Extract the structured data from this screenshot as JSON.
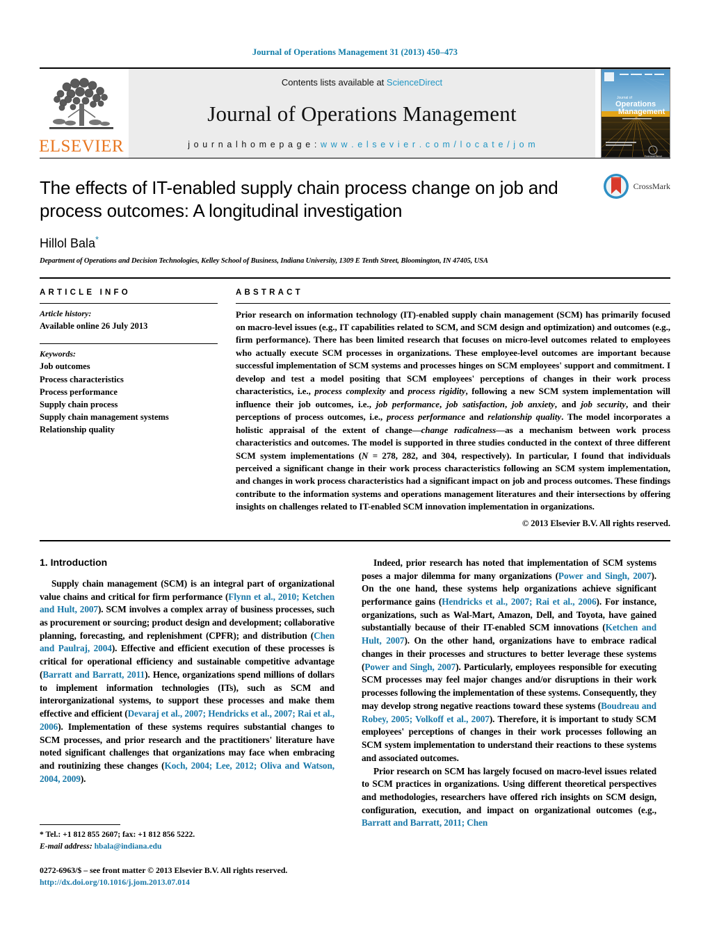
{
  "running_head": "Journal of Operations Management 31 (2013) 450–473",
  "masthead": {
    "publisher_name": "ELSEVIER",
    "contents_prefix": "Contents lists available at",
    "sciencedirect": "ScienceDirect",
    "journal_title": "Journal of Operations Management",
    "homepage_label": "j o u r n a l   h o m e p a g e :",
    "homepage_url": "w w w . e l s e v i e r . c o m / l o c a t e / j o m",
    "cover_journal_of": "Journal of",
    "cover_title_line1": "Operations",
    "cover_title_line2": "Management",
    "cover_footer": "ScienceDirect"
  },
  "title_block": {
    "title": "The effects of IT-enabled supply chain process change on job and process outcomes: A longitudinal investigation",
    "author": "Hillol Bala",
    "author_marker": "*",
    "affiliation": "Department of Operations and Decision Technologies, Kelley School of Business, Indiana University, 1309 E Tenth Street, Bloomington, IN 47405, USA",
    "crossmark_label": "CrossMark"
  },
  "article_info": {
    "heading": "ARTICLE INFO",
    "history_label": "Article history:",
    "history_value": "Available online 26 July 2013",
    "keywords_label": "Keywords:",
    "keywords": [
      "Job outcomes",
      "Process characteristics",
      "Process performance",
      "Supply chain process",
      "Supply chain management systems",
      "Relationship quality"
    ]
  },
  "abstract": {
    "heading": "ABSTRACT",
    "paragraph_1": "Prior research on information technology (IT)-enabled supply chain management (SCM) has primarily focused on macro-level issues (e.g., IT capabilities related to SCM, and SCM design and optimization) and outcomes (e.g., firm performance). There has been limited research that focuses on micro-level outcomes related to employees who actually execute SCM processes in organizations. These employee-level outcomes are important because successful implementation of SCM systems and processes hinges on SCM employees' support and commitment. I develop and test a model positing that SCM employees' perceptions of changes in their work process characteristics, i.e., ",
    "italic_1": "process complexity",
    "mid_1": " and ",
    "italic_2": "process rigidity",
    "mid_2": ", following a new SCM system implementation will influence their job outcomes, i.e., ",
    "italic_3": "job performance",
    "mid_3": ", ",
    "italic_4": "job satisfaction",
    "mid_4": ", ",
    "italic_5": "job anxiety",
    "mid_5": ", and ",
    "italic_6": "job security",
    "mid_6": ", and their perceptions of process outcomes, i.e., ",
    "italic_7": "process performance",
    "mid_7": " and ",
    "italic_8": "relationship quality",
    "mid_8": ". The model incorporates a holistic appraisal of the extent of change—",
    "italic_9": "change radicalness",
    "mid_9": "—as a mechanism between work process characteristics and outcomes. The model is supported in three studies conducted in the context of three different SCM system implementations (",
    "italic_10": "N",
    "mid_10": " = 278, 282, and 304, respectively). In particular, I found that individuals perceived a significant change in their work process characteristics following an SCM system implementation, and changes in work process characteristics had a significant impact on job and process outcomes. These findings contribute to the information systems and operations management literatures and their intersections by offering insights on challenges related to IT-enabled SCM innovation implementation in organizations.",
    "copyright": "© 2013 Elsevier B.V. All rights reserved."
  },
  "introduction": {
    "section_label": "1.  Introduction",
    "left_p1_a": "Supply chain management (SCM) is an integral part of organizational value chains and critical for firm performance (",
    "left_p1_c1": "Flynn et al., 2010; Ketchen and Hult, 2007",
    "left_p1_b": "). SCM involves a complex array of business processes, such as procurement or sourcing; product design and development; collaborative planning, forecasting, and replenishment (CPFR); and distribution (",
    "left_p1_c2": "Chen and Paulraj, 2004",
    "left_p1_c": "). Effective and efficient execution of these processes is critical for operational efficiency and sustainable competitive advantage (",
    "left_p1_c3": "Barratt and Barratt, 2011",
    "left_p1_d": "). Hence, organizations spend millions of dollars to implement information technologies (ITs), such as SCM and interorganizational systems, to support these processes and make them effective and efficient (",
    "left_p1_c4": "Devaraj et al., 2007; Hendricks et al., 2007; Rai et al., 2006",
    "left_p1_e": "). Implementation of these systems requires substantial changes to SCM processes, and prior research and the practitioners' literature have noted significant challenges that organizations may face when embracing and routinizing these changes (",
    "left_p1_c5": "Koch, 2004; Lee, 2012; Oliva and Watson, 2004, 2009",
    "left_p1_f": ").",
    "right_p1_a": "Indeed, prior research has noted that implementation of SCM systems poses a major dilemma for many organizations (",
    "right_p1_c1": "Power and Singh, 2007",
    "right_p1_b": "). On the one hand, these systems help organizations achieve significant performance gains (",
    "right_p1_c2": "Hendricks et al., 2007; Rai et al., 2006",
    "right_p1_c": "). For instance, organizations, such as Wal-Mart, Amazon, Dell, and Toyota, have gained substantially because of their IT-enabled SCM innovations (",
    "right_p1_c3": "Ketchen and Hult, 2007",
    "right_p1_d": "). On the other hand, organizations have to embrace radical changes in their processes and structures to better leverage these systems (",
    "right_p1_c4": "Power and Singh, 2007",
    "right_p1_e": "). Particularly, employees responsible for executing SCM processes may feel major changes and/or disruptions in their work processes following the implementation of these systems. Consequently, they may develop strong negative reactions toward these systems (",
    "right_p1_c5": "Boudreau and Robey, 2005; Volkoff et al., 2007",
    "right_p1_f": "). Therefore, it is important to study SCM employees' perceptions of changes in their work processes following an SCM system implementation to understand their reactions to these systems and associated outcomes.",
    "right_p2_a": "Prior research on SCM has largely focused on macro-level issues related to SCM practices in organizations. Using different theoretical perspectives and methodologies, researchers have offered rich insights on SCM design, configuration, execution, and impact on organizational outcomes (e.g., ",
    "right_p2_c1": "Barratt and Barratt, 2011; Chen"
  },
  "footnote": {
    "marker": "*",
    "tel": "Tel.: +1 812 855 2607; fax: +1 812 856 5222.",
    "email_label": "E-mail address:",
    "email": "hbala@indiana.edu",
    "issn": "0272-6963/$ – see front matter © 2013 Elsevier B.V. All rights reserved.",
    "doi": "http://dx.doi.org/10.1016/j.jom.2013.07.014"
  },
  "colors": {
    "link_blue": "#1878a8",
    "sciencedirect_blue": "#2196c4",
    "elsevier_orange": "#e87722",
    "banner_grey": "#ececec"
  }
}
